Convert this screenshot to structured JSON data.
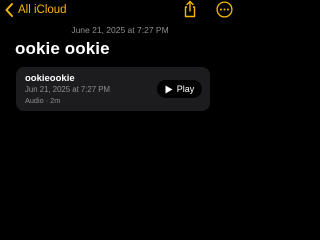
{
  "colors": {
    "accent": "#f5b800",
    "background": "#000000",
    "card": "#1c1c1e",
    "secondary_text": "#8e8e93"
  },
  "nav": {
    "back_label": "All iCloud",
    "back_icon": "chevron-left-icon",
    "share_icon": "share-icon",
    "more_icon": "ellipsis-circle-icon"
  },
  "note": {
    "timestamp": "June 21, 2025 at 7:27 PM",
    "title": "ookie ookie"
  },
  "audio": {
    "name": "ookieookie",
    "date": "Jun 21, 2025 at 7:27 PM",
    "meta": "Audio · 2m",
    "play_label": "Play",
    "play_icon": "play-icon"
  }
}
